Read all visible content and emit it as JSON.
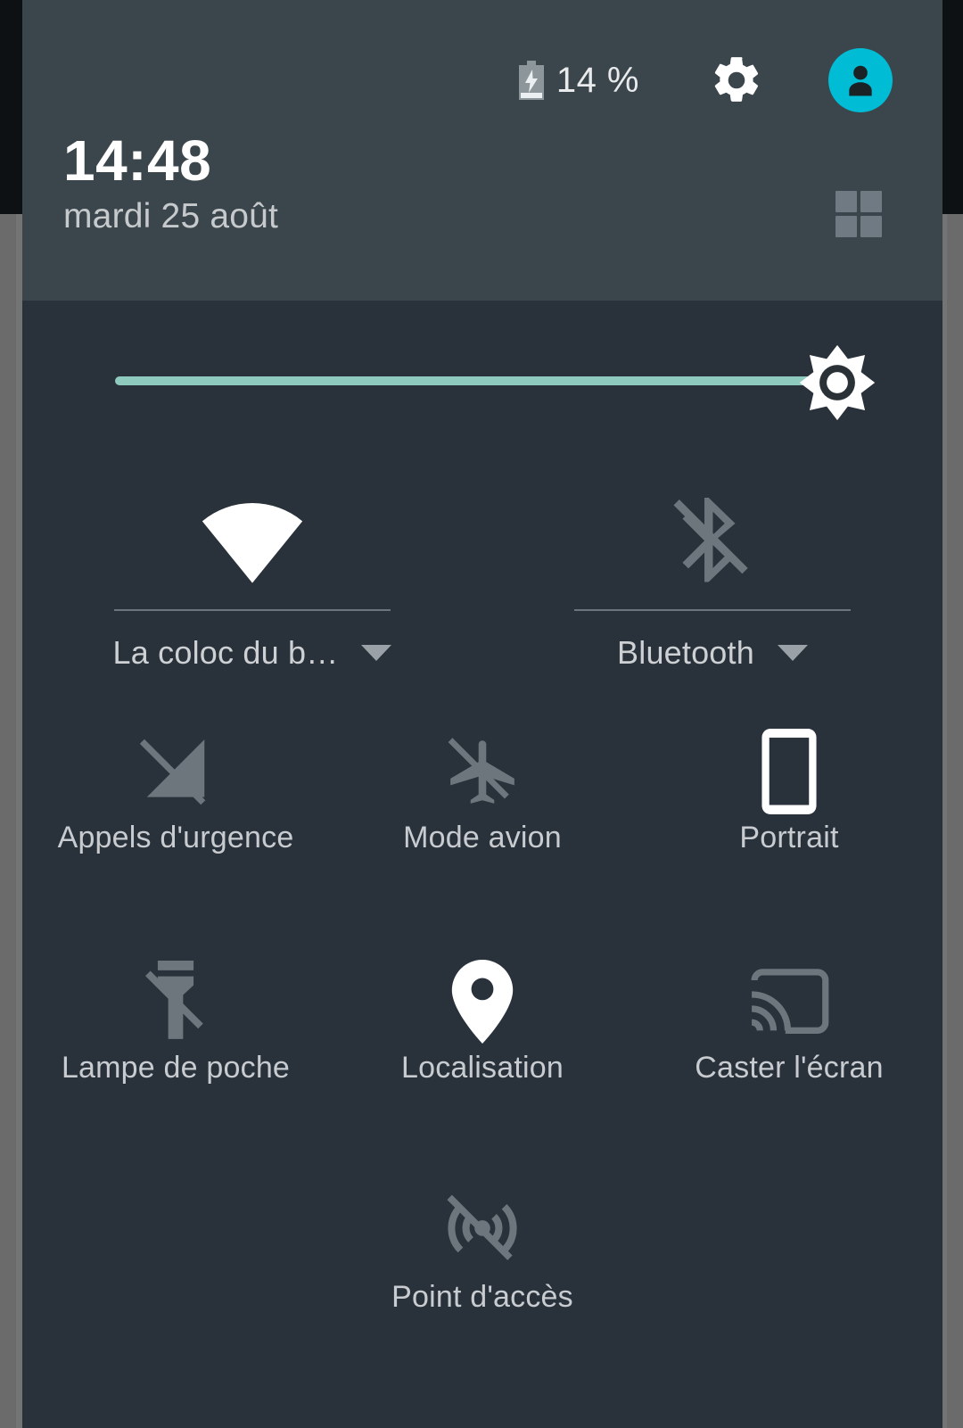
{
  "statusbar": {
    "battery_percent": "14 %",
    "battery_icon": "battery-charging-icon",
    "settings_icon": "gear-icon",
    "avatar_icon": "user-avatar-icon",
    "avatar_color": "#00bcd4"
  },
  "header": {
    "time": "14:48",
    "date": "mardi 25 août",
    "expand_icon": "grid-expand-icon",
    "background_color": "#3b464c"
  },
  "brightness": {
    "name": "brightness-slider",
    "value_percent": 96,
    "track_color": "#8ecbbe",
    "thumb_icon": "brightness-sun-icon"
  },
  "dual_tiles": [
    {
      "label": "La coloc du b…",
      "icon": "wifi-icon",
      "state": "on",
      "caret_icon": "chevron-down-icon"
    },
    {
      "label": "Bluetooth",
      "icon": "bluetooth-disabled-icon",
      "state": "off",
      "caret_icon": "chevron-down-icon"
    }
  ],
  "tiles": [
    {
      "label": "Appels d'urgence",
      "icon": "signal-off-icon",
      "state": "off"
    },
    {
      "label": "Mode avion",
      "icon": "airplane-off-icon",
      "state": "off"
    },
    {
      "label": "Portrait",
      "icon": "screen-rotation-portrait-icon",
      "state": "on"
    },
    {
      "label": "Lampe de poche",
      "icon": "flashlight-off-icon",
      "state": "off"
    },
    {
      "label": "Localisation",
      "icon": "location-pin-icon",
      "state": "on"
    },
    {
      "label": "Caster l'écran",
      "icon": "cast-screen-icon",
      "state": "off"
    },
    {
      "label": "Point d'accès",
      "icon": "hotspot-off-icon",
      "state": "off"
    }
  ],
  "theme": {
    "body_background": "#29313a",
    "label_color": "#c8ccd0",
    "icon_off_color": "#6c767c",
    "icon_on_color": "#ffffff"
  }
}
